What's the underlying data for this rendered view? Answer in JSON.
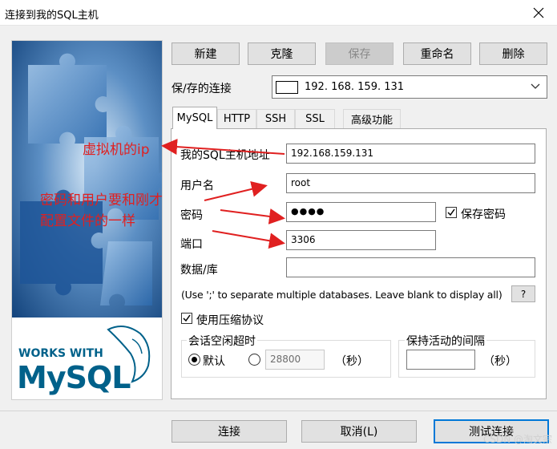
{
  "window": {
    "title": "连接到我的SQL主机"
  },
  "toolbar": {
    "new": "新建",
    "clone": "克隆",
    "save": "保存",
    "rename": "重命名",
    "delete": "删除"
  },
  "saved_connections": {
    "label": "保/存的连接",
    "value": "192. 168. 159. 131"
  },
  "tabs": [
    "MySQL",
    "HTTP",
    "SSH",
    "SSL",
    "高级功能"
  ],
  "form": {
    "host_label": "我的SQL主机地址",
    "host_value": "192.168.159.131",
    "user_label": "用户名",
    "user_value": "root",
    "password_label": "密码",
    "password_value": "●●●●",
    "save_password_label": "保存密码",
    "port_label": "端口",
    "port_value": "3306",
    "database_label": "数据/库",
    "database_value": "",
    "hint": "(Use ';' to separate multiple databases. Leave blank to display all)",
    "hint_button": "?",
    "compression_label": "使用压缩协议",
    "session_idle_title": "会话空闲超时",
    "default_label": "默认",
    "timeout_value": "28800",
    "seconds_label": "（秒）",
    "keepalive_title": "保持活动的间隔",
    "keepalive_value": "",
    "keepalive_seconds": "（秒）"
  },
  "annotations": {
    "vm_ip": "虚拟机的ip",
    "note_line1": "密码和用户要和刚才",
    "note_line2": "配置文件的一样"
  },
  "logo": {
    "works_with": "WORKS WITH",
    "mysql": "MySQL"
  },
  "footer": {
    "connect": "连接",
    "cancel": "取消(L)",
    "test": "测试连接",
    "watermark": "CSDN @淘文宗"
  },
  "colors": {
    "accent": "#0078d7",
    "annotation": "#e02020",
    "mysql_blue": "#00618a",
    "mysql_orange": "#e48e00"
  }
}
